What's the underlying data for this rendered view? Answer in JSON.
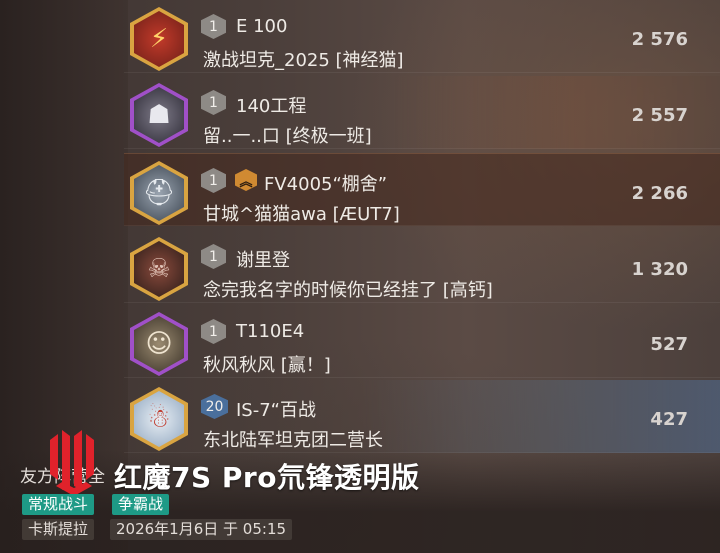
{
  "rows": [
    {
      "level": "1",
      "tank": "E 100",
      "player": "激战坦克_2025 [神经猫]",
      "score": "2 576",
      "badge_color": "#d9a441",
      "avatar_icon": "lightning-emblem-icon"
    },
    {
      "level": "1",
      "tank": "140工程",
      "player": "留..一..口 [终极一班]",
      "score": "2 557",
      "badge_color": "#a050c8",
      "avatar_icon": "hooded-figure-icon"
    },
    {
      "level": "1",
      "tank": "FV4005“棚舍”",
      "player": "甘城^猫猫awa [ÆUT7]",
      "score": "2 266",
      "badge_color": "#d9a441",
      "avatar_icon": "helmet-icon",
      "rank_icon": "chevron-rank-icon"
    },
    {
      "level": "1",
      "tank": "谢里登",
      "player": "念完我名字的时候你已经挂了 [高钙]",
      "score": "1 320",
      "badge_color": "#d9a441",
      "avatar_icon": "masked-soldier-icon"
    },
    {
      "level": "1",
      "tank": "T110E4",
      "player": "秋风秋风 [赢！]",
      "score": "527",
      "badge_color": "#a050c8",
      "avatar_icon": "man-portrait-icon"
    },
    {
      "level": "20",
      "tank": "IS-7“百战",
      "player": "东北陆军坦克团二营长",
      "score": "427",
      "badge_color": "#d9a441",
      "avatar_icon": "snowman-icon"
    }
  ],
  "footer": {
    "side_title": "友方阵营全",
    "watermark": "红魔7S Pro氘锋透明版",
    "mode_tag": "常规战斗",
    "type_tag": "争霸战",
    "map_name": "卡斯提拉",
    "datetime": "2026年1月6日 于 05:15"
  }
}
